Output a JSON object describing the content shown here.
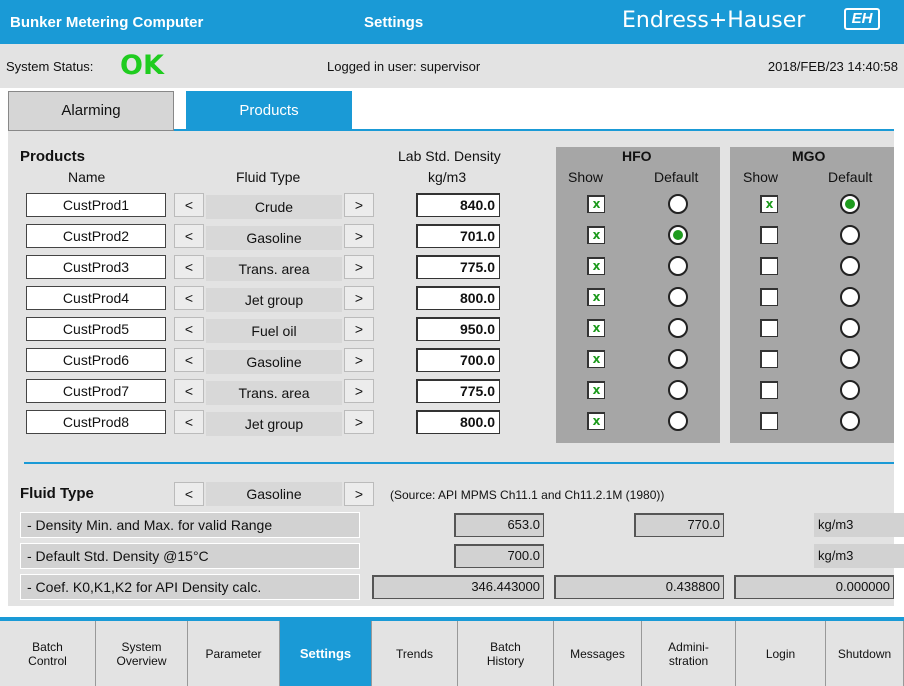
{
  "header": {
    "app_title": "Bunker Metering Computer",
    "page_title": "Settings",
    "brand": "Endress+Hauser",
    "logo_text": "EH"
  },
  "status": {
    "label": "System Status:",
    "value": "OK",
    "user": "Logged in user: supervisor",
    "datetime": "2018/FEB/23  14:40:58",
    "ok_color": "#1fcc1f"
  },
  "tabs": [
    {
      "label": "Alarming",
      "active": false
    },
    {
      "label": "Products",
      "active": true
    }
  ],
  "products": {
    "section_title": "Products",
    "col_name": "Name",
    "col_fluid": "Fluid Type",
    "col_density_line1": "Lab Std. Density",
    "col_density_line2": "kg/m3",
    "hfo_title": "HFO",
    "mgo_title": "MGO",
    "show_label": "Show",
    "default_label": "Default",
    "prev_icon": "<",
    "next_icon": ">",
    "check_mark": "x",
    "rows": [
      {
        "name": "CustProd1",
        "fluid": "Crude",
        "density": "840.0",
        "hfo_show": true,
        "hfo_default": false,
        "mgo_show": true,
        "mgo_default": true
      },
      {
        "name": "CustProd2",
        "fluid": "Gasoline",
        "density": "701.0",
        "hfo_show": true,
        "hfo_default": true,
        "mgo_show": false,
        "mgo_default": false
      },
      {
        "name": "CustProd3",
        "fluid": "Trans. area",
        "density": "775.0",
        "hfo_show": true,
        "hfo_default": false,
        "mgo_show": false,
        "mgo_default": false
      },
      {
        "name": "CustProd4",
        "fluid": "Jet group",
        "density": "800.0",
        "hfo_show": true,
        "hfo_default": false,
        "mgo_show": false,
        "mgo_default": false
      },
      {
        "name": "CustProd5",
        "fluid": "Fuel oil",
        "density": "950.0",
        "hfo_show": true,
        "hfo_default": false,
        "mgo_show": false,
        "mgo_default": false
      },
      {
        "name": "CustProd6",
        "fluid": "Gasoline",
        "density": "700.0",
        "hfo_show": true,
        "hfo_default": false,
        "mgo_show": false,
        "mgo_default": false
      },
      {
        "name": "CustProd7",
        "fluid": "Trans. area",
        "density": "775.0",
        "hfo_show": true,
        "hfo_default": false,
        "mgo_show": false,
        "mgo_default": false
      },
      {
        "name": "CustProd8",
        "fluid": "Jet group",
        "density": "800.0",
        "hfo_show": true,
        "hfo_default": false,
        "mgo_show": false,
        "mgo_default": false
      }
    ]
  },
  "fluid_section": {
    "title": "Fluid Type",
    "selected": "Gasoline",
    "source": "(Source: API MPMS Ch11.1 and Ch11.2.1M (1980))",
    "rows": [
      {
        "label": "- Density Min. and Max. for valid Range",
        "min": "653.0",
        "max": "770.0",
        "unit": "kg/m3"
      },
      {
        "label": "- Default Std. Density @15°C",
        "value": "700.0",
        "unit": "kg/m3"
      },
      {
        "label": "- Coef. K0,K1,K2 for API Density calc.",
        "k0": "346.443000",
        "k1": "0.438800",
        "k2": "0.000000"
      }
    ]
  },
  "nav": [
    {
      "label": "Batch\nControl",
      "active": false
    },
    {
      "label": "System\nOverview",
      "active": false
    },
    {
      "label": "Parameter",
      "active": false
    },
    {
      "label": "Settings",
      "active": true
    },
    {
      "label": "Trends",
      "active": false
    },
    {
      "label": "Batch\nHistory",
      "active": false
    },
    {
      "label": "Messages",
      "active": false
    },
    {
      "label": "Admini-\nstration",
      "active": false
    },
    {
      "label": "Login",
      "active": false
    },
    {
      "label": "Shutdown",
      "active": false
    }
  ]
}
